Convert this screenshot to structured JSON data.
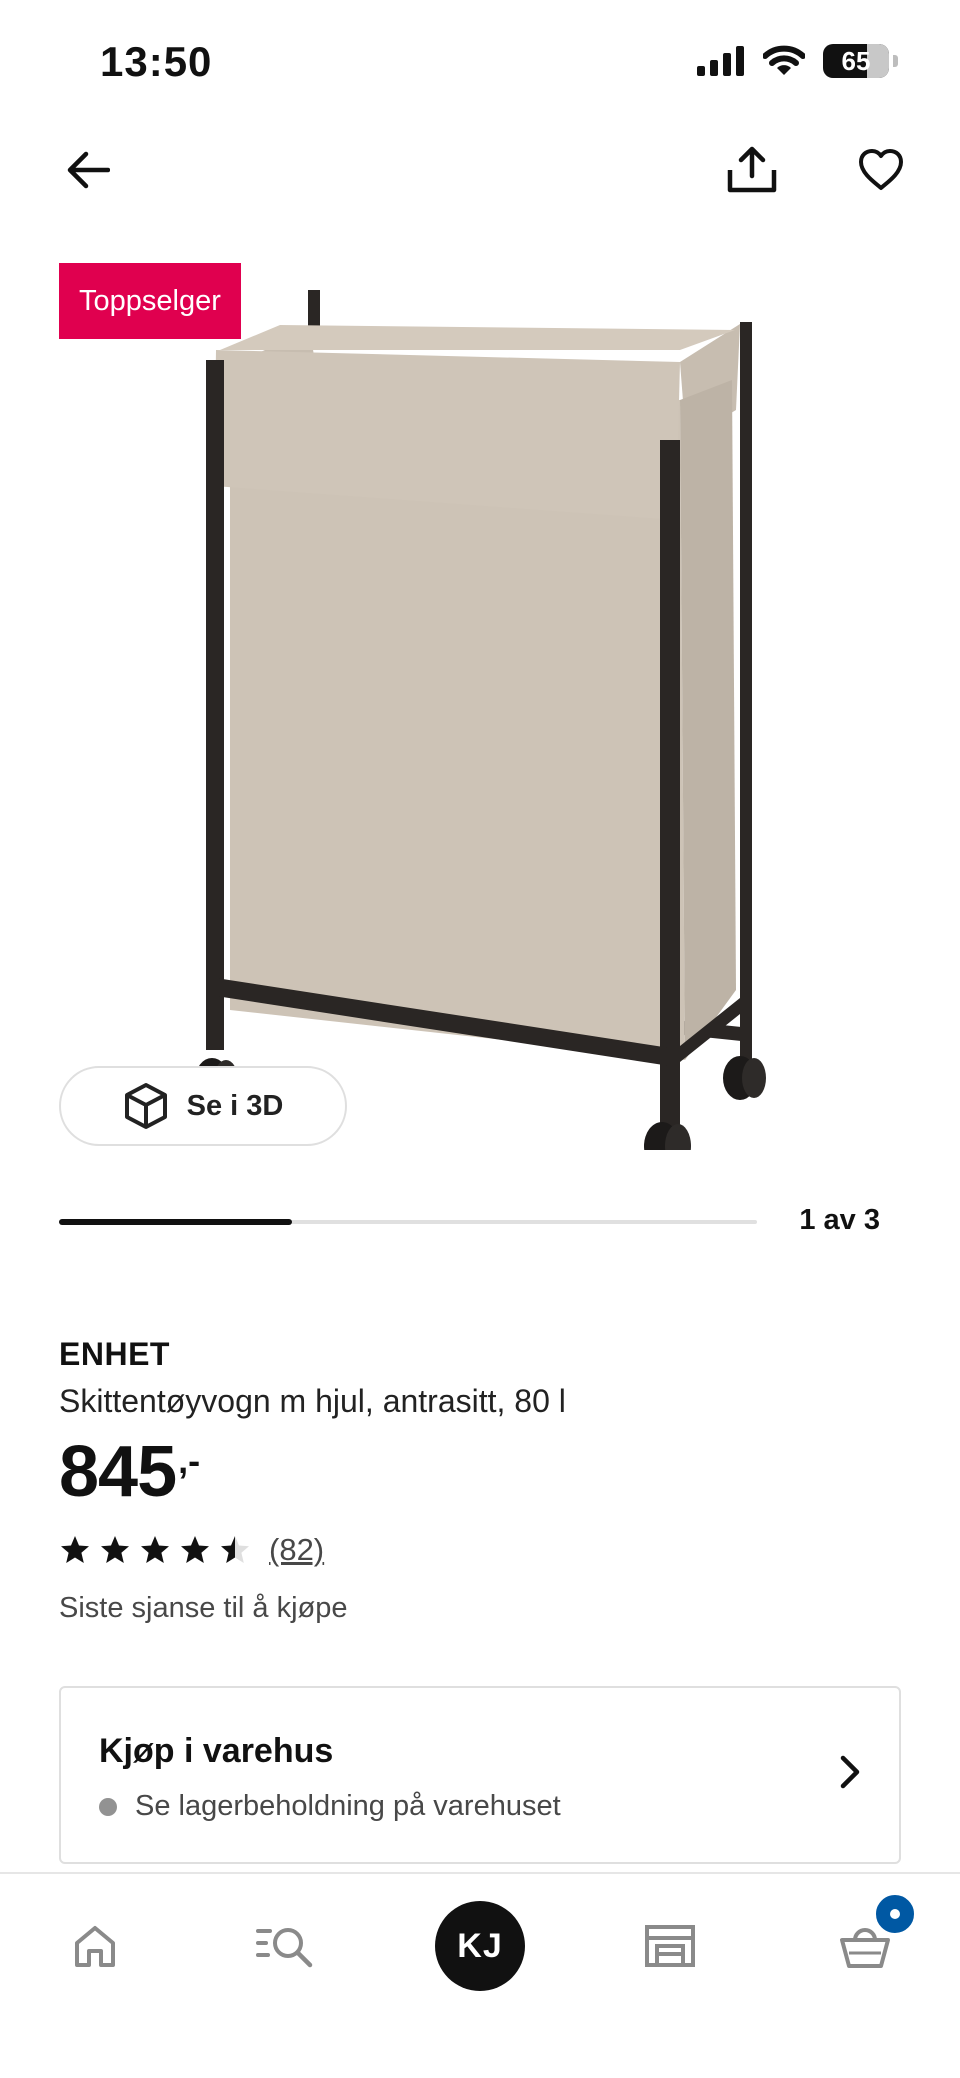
{
  "status_bar": {
    "time": "13:50",
    "battery": "65"
  },
  "top_nav": {
    "back_icon": "arrow-left-icon",
    "share_icon": "share-icon",
    "favorite_icon": "heart-icon"
  },
  "gallery": {
    "badge": "Toppselger",
    "badge_color": "#e0004f",
    "view_3d_label": "Se i 3D",
    "current_image": 1,
    "total_images": 3,
    "counter": "1 av 3"
  },
  "product": {
    "brand": "ENHET",
    "description": "Skittentøyvogn m hjul, antrasitt, 80 l",
    "price": "845",
    "price_suffix": ",-",
    "rating": 4.5,
    "rating_max": 5,
    "review_count": "(82)",
    "availability": "Siste sjanse til å kjøpe"
  },
  "store_card": {
    "title": "Kjøp i varehus",
    "subtitle": "Se lagerbeholdning på varehuset",
    "status_color": "#929292"
  },
  "tab_bar": {
    "avatar_initials": "KJ",
    "cart_badge_color": "#0058a3",
    "icons": [
      "home-icon",
      "search-list-icon",
      "profile-avatar",
      "store-icon",
      "cart-icon"
    ]
  }
}
